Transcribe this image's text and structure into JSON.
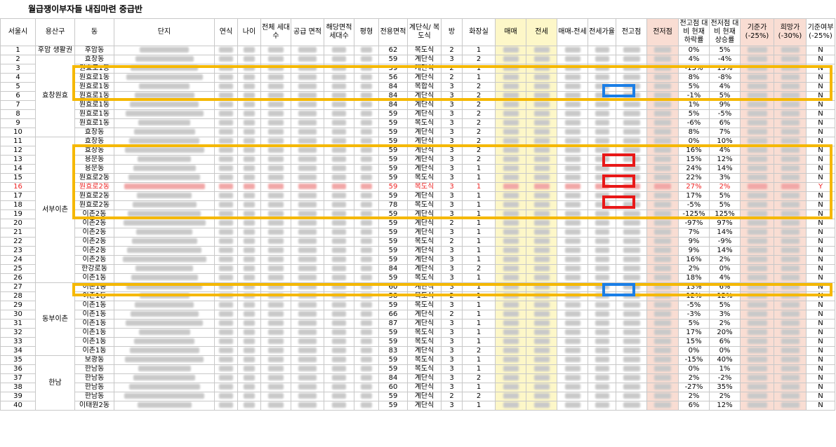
{
  "title": "월급쟁이부자들 내집마련 중급반",
  "headers": [
    "서울시",
    "용산구",
    "동",
    "단지",
    "연식",
    "나이",
    "전체 세대수",
    "공급 면적",
    "해당면적 세대수",
    "평형",
    "전용면적",
    "계단식/ 복도식",
    "방",
    "화장실",
    "매매",
    "전세",
    "매매-전세",
    "전세가율",
    "전고점",
    "전저점",
    "전고점 대비 현재 하락률",
    "전저점 대비 현재 상승률",
    "기준가 (-25%)",
    "희망가 (-30%)",
    "기준여부 (-25%)"
  ],
  "groups": [
    {
      "start": 0,
      "span": 1,
      "label": "후암 생활권"
    },
    {
      "start": 1,
      "span": 9,
      "label": "효창원효"
    },
    {
      "start": 10,
      "span": 16,
      "label": "서부이촌"
    },
    {
      "start": 26,
      "span": 8,
      "label": "동부이촌"
    },
    {
      "start": 34,
      "span": 6,
      "label": "한남"
    }
  ],
  "rows": [
    {
      "no": "1",
      "dong": "후암동",
      "area": "62",
      "stair": "복도식",
      "bed": "2",
      "bath": "1",
      "drop": "0%",
      "rise": "5%",
      "flag": "N"
    },
    {
      "no": "2",
      "dong": "효창동",
      "area": "59",
      "stair": "계단식",
      "bed": "3",
      "bath": "2",
      "drop": "4%",
      "rise": "-4%",
      "flag": "N"
    },
    {
      "no": "3",
      "dong": "원효로1동",
      "area": "59",
      "stair": "계단식",
      "bed": "2",
      "bath": "1",
      "drop": "-13%",
      "rise": "13%",
      "flag": "N"
    },
    {
      "no": "4",
      "dong": "원효로1동",
      "area": "56",
      "stair": "계단식",
      "bed": "2",
      "bath": "1",
      "drop": "8%",
      "rise": "-8%",
      "flag": "N"
    },
    {
      "no": "5",
      "dong": "원효로1동",
      "area": "84",
      "stair": "복합식",
      "bed": "3",
      "bath": "2",
      "drop": "5%",
      "rise": "4%",
      "flag": "N"
    },
    {
      "no": "6",
      "dong": "원효로1동",
      "area": "84",
      "stair": "계단식",
      "bed": "3",
      "bath": "2",
      "drop": "-1%",
      "rise": "5%",
      "flag": "N"
    },
    {
      "no": "7",
      "dong": "원효로1동",
      "area": "84",
      "stair": "계단식",
      "bed": "3",
      "bath": "2",
      "drop": "1%",
      "rise": "9%",
      "flag": "N"
    },
    {
      "no": "8",
      "dong": "원효로1동",
      "area": "59",
      "stair": "계단식",
      "bed": "3",
      "bath": "2",
      "drop": "5%",
      "rise": "-5%",
      "flag": "N"
    },
    {
      "no": "9",
      "dong": "원효로1동",
      "area": "59",
      "stair": "복도식",
      "bed": "3",
      "bath": "2",
      "drop": "-6%",
      "rise": "6%",
      "flag": "N"
    },
    {
      "no": "10",
      "dong": "효창동",
      "area": "59",
      "stair": "계단식",
      "bed": "3",
      "bath": "2",
      "drop": "8%",
      "rise": "7%",
      "flag": "N"
    },
    {
      "no": "11",
      "dong": "효창동",
      "area": "59",
      "stair": "계단식",
      "bed": "3",
      "bath": "2",
      "drop": "0%",
      "rise": "10%",
      "flag": "N"
    },
    {
      "no": "12",
      "dong": "효창동",
      "area": "59",
      "stair": "계단식",
      "bed": "3",
      "bath": "2",
      "drop": "16%",
      "rise": "4%",
      "flag": "N"
    },
    {
      "no": "13",
      "dong": "용문동",
      "area": "59",
      "stair": "계단식",
      "bed": "3",
      "bath": "2",
      "drop": "15%",
      "rise": "12%",
      "flag": "N"
    },
    {
      "no": "14",
      "dong": "용문동",
      "area": "59",
      "stair": "계단식",
      "bed": "3",
      "bath": "1",
      "drop": "24%",
      "rise": "14%",
      "flag": "N"
    },
    {
      "no": "15",
      "dong": "원효로2동",
      "area": "59",
      "stair": "복도식",
      "bed": "3",
      "bath": "1",
      "drop": "22%",
      "rise": "3%",
      "flag": "N"
    },
    {
      "no": "16",
      "dong": "원효로2동",
      "area": "59",
      "stair": "복도식",
      "bed": "3",
      "bath": "1",
      "drop": "27%",
      "rise": "2%",
      "flag": "Y",
      "red": true
    },
    {
      "no": "17",
      "dong": "원효로2동",
      "area": "59",
      "stair": "계단식",
      "bed": "3",
      "bath": "1",
      "drop": "17%",
      "rise": "5%",
      "flag": "N"
    },
    {
      "no": "18",
      "dong": "원효로2동",
      "area": "78",
      "stair": "복도식",
      "bed": "3",
      "bath": "1",
      "drop": "-5%",
      "rise": "5%",
      "flag": "N"
    },
    {
      "no": "19",
      "dong": "이촌2동",
      "area": "59",
      "stair": "계단식",
      "bed": "3",
      "bath": "1",
      "drop": "-125%",
      "rise": "125%",
      "flag": "N"
    },
    {
      "no": "20",
      "dong": "이촌2동",
      "area": "59",
      "stair": "계단식",
      "bed": "2",
      "bath": "1",
      "drop": "-97%",
      "rise": "97%",
      "flag": "N"
    },
    {
      "no": "21",
      "dong": "이촌2동",
      "area": "59",
      "stair": "계단식",
      "bed": "3",
      "bath": "1",
      "drop": "7%",
      "rise": "14%",
      "flag": "N"
    },
    {
      "no": "22",
      "dong": "이촌2동",
      "area": "59",
      "stair": "복도식",
      "bed": "2",
      "bath": "1",
      "drop": "9%",
      "rise": "-9%",
      "flag": "N"
    },
    {
      "no": "23",
      "dong": "이촌2동",
      "area": "59",
      "stair": "계단식",
      "bed": "3",
      "bath": "1",
      "drop": "9%",
      "rise": "14%",
      "flag": "N"
    },
    {
      "no": "24",
      "dong": "이촌2동",
      "area": "59",
      "stair": "계단식",
      "bed": "3",
      "bath": "1",
      "drop": "16%",
      "rise": "2%",
      "flag": "N"
    },
    {
      "no": "25",
      "dong": "한강로동",
      "area": "84",
      "stair": "계단식",
      "bed": "3",
      "bath": "2",
      "drop": "2%",
      "rise": "0%",
      "flag": "N"
    },
    {
      "no": "26",
      "dong": "이촌1동",
      "area": "59",
      "stair": "복도식",
      "bed": "3",
      "bath": "1",
      "drop": "18%",
      "rise": "4%",
      "flag": "N"
    },
    {
      "no": "27",
      "dong": "이촌1동",
      "area": "60",
      "stair": "계단식",
      "bed": "3",
      "bath": "1",
      "drop": "13%",
      "rise": "6%",
      "flag": "N"
    },
    {
      "no": "28",
      "dong": "이촌1동",
      "area": "58",
      "stair": "복도식",
      "bed": "2",
      "bath": "1",
      "drop": "12%",
      "rise": "12%",
      "flag": "N"
    },
    {
      "no": "29",
      "dong": "이촌1동",
      "area": "59",
      "stair": "복도식",
      "bed": "3",
      "bath": "1",
      "drop": "-5%",
      "rise": "5%",
      "flag": "N"
    },
    {
      "no": "30",
      "dong": "이촌1동",
      "area": "66",
      "stair": "계단식",
      "bed": "2",
      "bath": "1",
      "drop": "-3%",
      "rise": "3%",
      "flag": "N"
    },
    {
      "no": "31",
      "dong": "이촌1동",
      "area": "87",
      "stair": "계단식",
      "bed": "3",
      "bath": "1",
      "drop": "5%",
      "rise": "2%",
      "flag": "N"
    },
    {
      "no": "32",
      "dong": "이촌1동",
      "area": "59",
      "stair": "복도식",
      "bed": "3",
      "bath": "1",
      "drop": "17%",
      "rise": "20%",
      "flag": "N"
    },
    {
      "no": "33",
      "dong": "이촌1동",
      "area": "59",
      "stair": "복도식",
      "bed": "3",
      "bath": "1",
      "drop": "15%",
      "rise": "6%",
      "flag": "N"
    },
    {
      "no": "34",
      "dong": "이촌1동",
      "area": "83",
      "stair": "계단식",
      "bed": "3",
      "bath": "2",
      "drop": "0%",
      "rise": "0%",
      "flag": "N"
    },
    {
      "no": "35",
      "dong": "보광동",
      "area": "59",
      "stair": "복도식",
      "bed": "3",
      "bath": "1",
      "drop": "-15%",
      "rise": "40%",
      "flag": "N"
    },
    {
      "no": "36",
      "dong": "한남동",
      "area": "59",
      "stair": "복도식",
      "bed": "3",
      "bath": "1",
      "drop": "0%",
      "rise": "1%",
      "flag": "N"
    },
    {
      "no": "37",
      "dong": "한남동",
      "area": "84",
      "stair": "계단식",
      "bed": "3",
      "bath": "2",
      "drop": "2%",
      "rise": "-2%",
      "flag": "N"
    },
    {
      "no": "38",
      "dong": "한남동",
      "area": "60",
      "stair": "계단식",
      "bed": "3",
      "bath": "1",
      "drop": "-27%",
      "rise": "35%",
      "flag": "N"
    },
    {
      "no": "39",
      "dong": "한남동",
      "area": "59",
      "stair": "계단식",
      "bed": "2",
      "bath": "2",
      "drop": "2%",
      "rise": "2%",
      "flag": "N"
    },
    {
      "no": "40",
      "dong": "이태원2동",
      "area": "59",
      "stair": "계단식",
      "bed": "3",
      "bath": "1",
      "drop": "6%",
      "rise": "12%",
      "flag": "N"
    }
  ],
  "colors": {
    "orange_box": "#f5b800",
    "blue_box": "#1a7ee6",
    "red_box": "#e81818",
    "yellow_fill": "#fdf7c8",
    "pink_fill": "#f9ddd3"
  }
}
